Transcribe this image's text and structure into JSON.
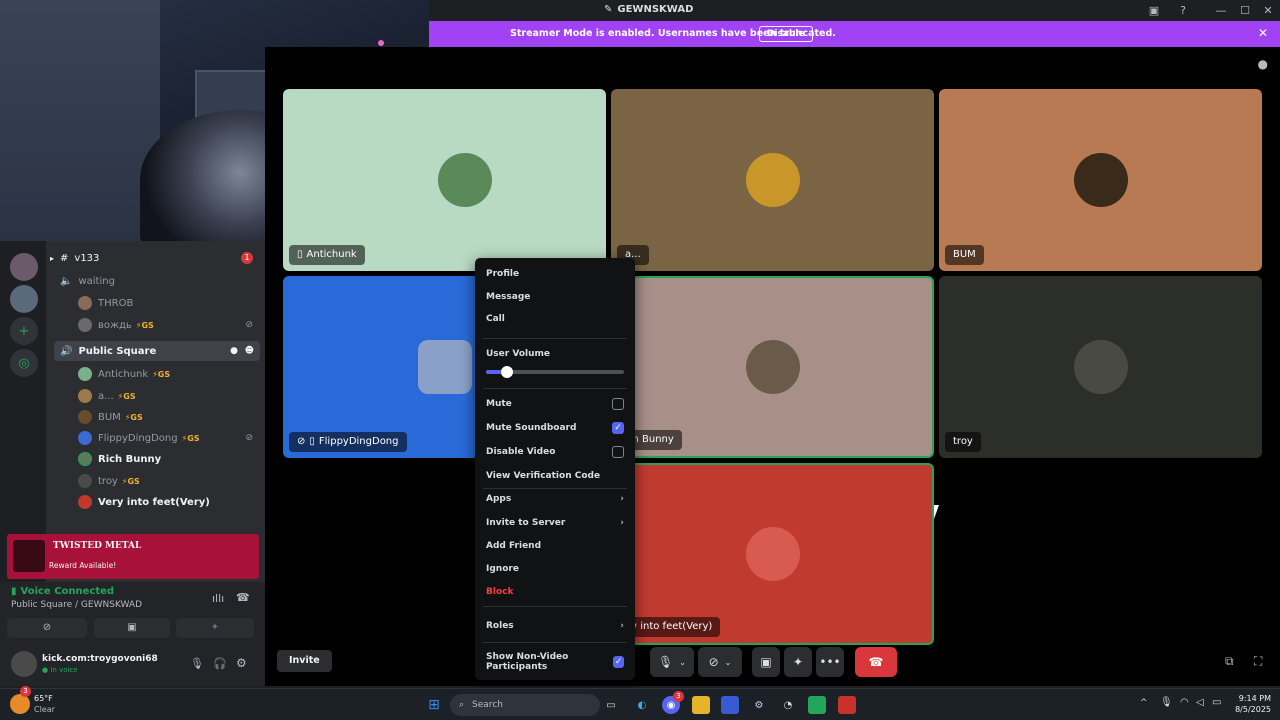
{
  "window": {
    "title": "GEWNSKWAD"
  },
  "banner": {
    "message": "Streamer Mode is enabled. Usernames have been truncated.",
    "disable_label": "Disable"
  },
  "channels": {
    "v133": {
      "name": "v133",
      "badge": "1"
    },
    "waiting": {
      "name": "waiting",
      "members": [
        {
          "name": "THROB",
          "tag": ""
        },
        {
          "name": "вождь",
          "tag": "⚡GS"
        }
      ]
    },
    "public_square": {
      "name": "Public Square",
      "members": [
        {
          "name": "Antichunk",
          "tag": "⚡GS"
        },
        {
          "name": "a...",
          "tag": "⚡GS"
        },
        {
          "name": "BUM",
          "tag": "⚡GS"
        },
        {
          "name": "FlippyDingDong",
          "tag": "⚡GS"
        },
        {
          "name": "Rich Bunny",
          "tag": ""
        },
        {
          "name": "troy",
          "tag": "⚡GS"
        },
        {
          "name": "Very into feet(Very)",
          "tag": ""
        }
      ]
    }
  },
  "promo": {
    "logo": "TWISTED METAL",
    "text": "Reward Available!"
  },
  "voice": {
    "status": "Voice Connected",
    "location": "Public Square / GEWNSKWAD"
  },
  "user": {
    "name": "kick.com:troygovoni68",
    "status": "In voice"
  },
  "tiles": [
    {
      "name": "Antichunk"
    },
    {
      "name": "a..."
    },
    {
      "name": "BUM"
    },
    {
      "name": "FlippyDingDong"
    },
    {
      "name": "ch Bunny"
    },
    {
      "name": "troy"
    },
    {
      "name": "ry into feet(Very)"
    }
  ],
  "invite_label": "Invite",
  "context_menu": {
    "profile": "Profile",
    "message": "Message",
    "call": "Call",
    "user_volume": "User Volume",
    "volume_value": 0.15,
    "mute": "Mute",
    "mute_soundboard": "Mute Soundboard",
    "disable_video": "Disable Video",
    "view_verification_code": "View Verification Code",
    "apps": "Apps",
    "invite_to_server": "Invite to Server",
    "add_friend": "Add Friend",
    "ignore": "Ignore",
    "block": "Block",
    "roles": "Roles",
    "show_non_video": "Show Non-Video Participants"
  },
  "taskbar": {
    "temp": "65°F",
    "weather": "Clear",
    "search": "Search",
    "time": "9:14 PM",
    "date": "8/5/2025",
    "weather_badge": "3",
    "discord_badge": "3"
  },
  "colors": {
    "accent": "#5865f2",
    "streamer": "#a142f4",
    "green": "#23a55a",
    "red": "#da373c"
  }
}
